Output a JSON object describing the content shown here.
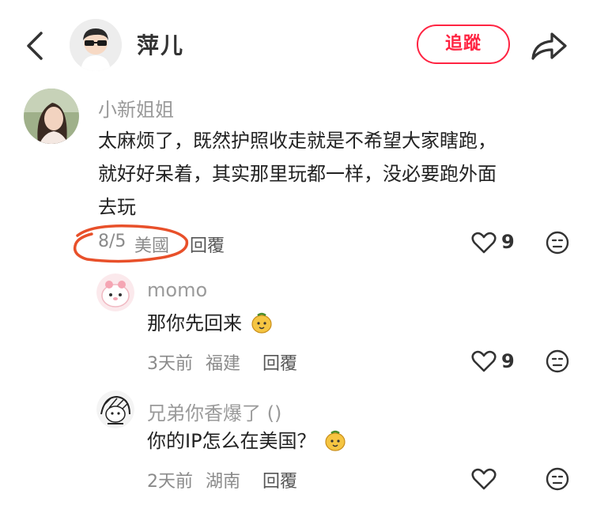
{
  "header": {
    "username": "萍儿",
    "follow_label": "追蹤"
  },
  "comments": [
    {
      "name": "小新姐姐",
      "text_lines": [
        "太麻烦了，既然护照收走就是不希望大家瞎跑，",
        "就好好呆着，其实那里玩都一样，没必要跑外面",
        "去玩"
      ],
      "date": "8/5",
      "location": "美國",
      "reply_label": "回覆",
      "likes": "9",
      "annotation_color": "#e8502a"
    }
  ],
  "replies": [
    {
      "name": "momo",
      "text": "那你先回来",
      "date": "3天前",
      "location": "福建",
      "reply_label": "回覆",
      "likes": "9"
    },
    {
      "name": "兄弟你香爆了 ()",
      "text": "你的IP怎么在美国？",
      "date": "2天前",
      "location": "湖南",
      "reply_label": "回覆",
      "likes": ""
    }
  ],
  "colors": {
    "accent": "#ff2442"
  }
}
